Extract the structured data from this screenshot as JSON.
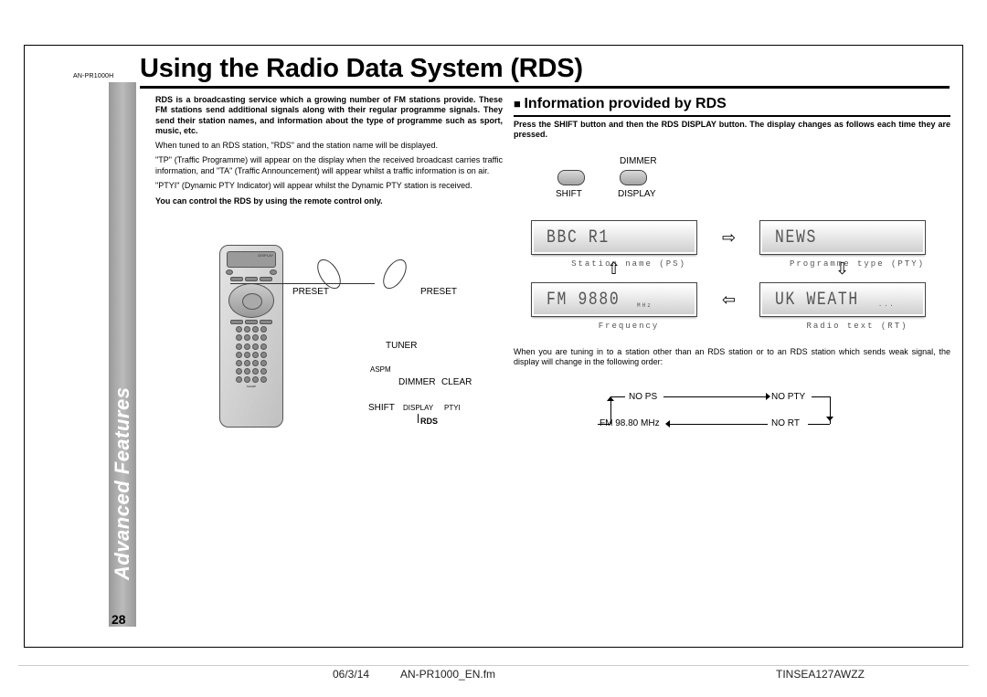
{
  "model": "AN-PR1000H",
  "page_title": "Using the Radio Data System (RDS)",
  "sidebar": "Advanced Features",
  "page_number": "28",
  "intro": {
    "p1_bold": "RDS is a broadcasting service which a growing number of FM stations provide. These FM stations send additional signals along with their regular programme signals. They send their station names, and information about the type of programme such as sport, music, etc.",
    "p2": "When tuned to an RDS station, \"RDS\" and the station name will be displayed.",
    "p3": "\"TP\" (Traffic Programme) will appear on the display when the received broadcast carries traffic information, and \"TA\" (Traffic Announcement) will appear whilst a traffic information is on air.",
    "p4": "\"PTYI\" (Dynamic PTY Indicator) will appear whilst the Dynamic PTY station is received.",
    "control_note": "You can control the RDS by using the remote control only."
  },
  "remote_callouts": {
    "preset": "PRESET",
    "tuner": "TUNER",
    "aspm": "ASPM",
    "dimmer": "DIMMER",
    "clear": "CLEAR",
    "shift": "SHIFT",
    "display": "DISPLAY",
    "ptyi": "PTYI",
    "rds": "RDS"
  },
  "right": {
    "heading": "Information provided by RDS",
    "intro": "Press the SHIFT button and then the RDS DISPLAY button. The display changes as follows each time they are pressed.",
    "btn_shift": "SHIFT",
    "btn_dimmer": "DIMMER",
    "btn_display": "DISPLAY"
  },
  "lcd": {
    "ps": "BBC R1",
    "ps_sub": "Station name (PS)",
    "pty": "NEWS",
    "pty_sub": "Programme type (PTY)",
    "freq": "FM  9880",
    "freq_small": "MHz",
    "freq_sub": "Frequency",
    "rt": "UK WEATH",
    "rt_small": "...",
    "rt_sub": "Radio text (RT)"
  },
  "order_note": "When you are tuning in to a station other than an RDS station or to an RDS station which sends weak signal, the display will change in the following order:",
  "flow": {
    "a": "NO PS",
    "b": "NO PTY",
    "c": "FM 98.80 MHz",
    "d": "NO RT"
  },
  "footer": {
    "date": "06/3/14",
    "file": "AN-PR1000_EN.fm",
    "code": "TINSEA127AWZZ"
  }
}
